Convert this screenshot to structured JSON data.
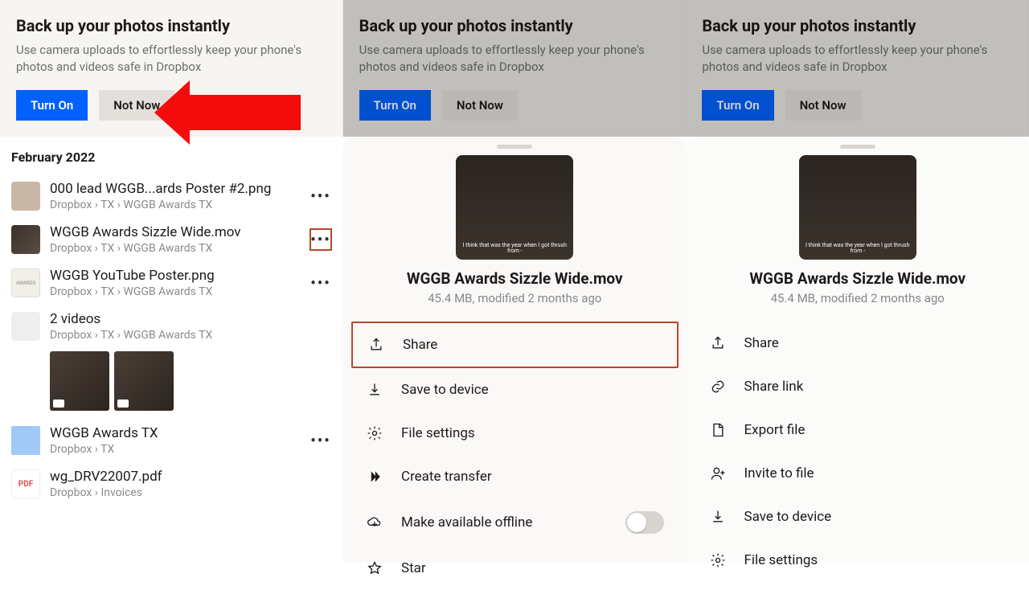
{
  "banner": {
    "title": "Back up your photos instantly",
    "desc": "Use camera uploads to effortlessly keep your phone's photos and videos safe in Dropbox",
    "primary": "Turn On",
    "secondary": "Not Now"
  },
  "section": "February 2022",
  "files": [
    {
      "name": "000 lead WGGB...ards Poster #2.png",
      "path": "Dropbox › TX › WGGB Awards TX"
    },
    {
      "name": "WGGB Awards Sizzle Wide.mov",
      "path": "Dropbox › TX › WGGB Awards TX"
    },
    {
      "name": "WGGB YouTube Poster.png",
      "path": "Dropbox › TX › WGGB Awards TX"
    },
    {
      "name": "2 videos",
      "path": "Dropbox › TX › WGGB Awards TX"
    },
    {
      "name": "WGGB Awards TX",
      "path": "Dropbox › TX"
    },
    {
      "name": "wg_DRV22007.pdf",
      "path": "Dropbox › Invoices"
    }
  ],
  "panel": {
    "title": "WGGB Awards Sizzle Wide.mov",
    "meta": "45.4 MB, modified 2 months ago",
    "caption": "I think that was the year when I got thrush from -"
  },
  "actions_a": [
    {
      "label": "Share",
      "icon": "share"
    },
    {
      "label": "Save to device",
      "icon": "download"
    },
    {
      "label": "File settings",
      "icon": "gear"
    },
    {
      "label": "Create transfer",
      "icon": "transfer"
    },
    {
      "label": "Make available offline",
      "icon": "cloud",
      "toggle": true
    },
    {
      "label": "Star",
      "icon": "star"
    }
  ],
  "actions_b": [
    {
      "label": "Share",
      "icon": "share"
    },
    {
      "label": "Share link",
      "icon": "link"
    },
    {
      "label": "Export file",
      "icon": "export"
    },
    {
      "label": "Invite to file",
      "icon": "invite"
    },
    {
      "label": "Save to device",
      "icon": "download"
    },
    {
      "label": "File settings",
      "icon": "gear"
    }
  ]
}
